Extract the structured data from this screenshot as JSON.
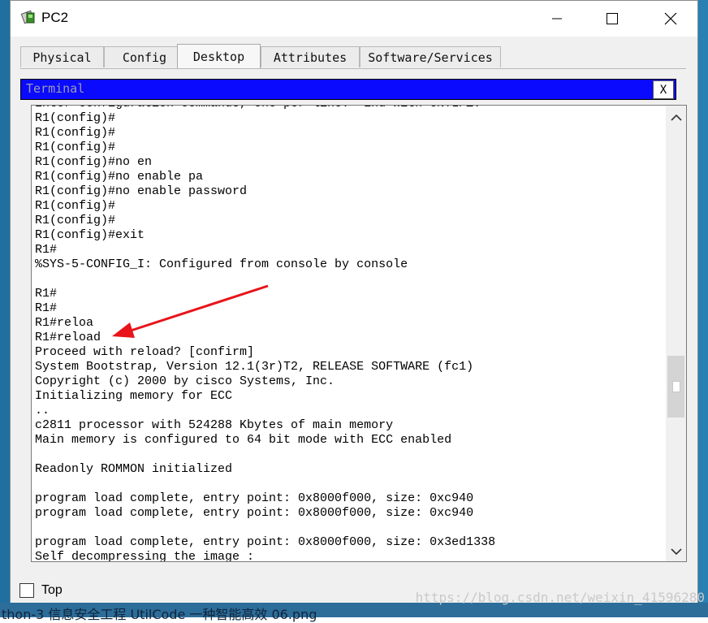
{
  "window": {
    "title": "PC2",
    "controls": {
      "minimize": "minimize-icon",
      "maximize": "maximize-icon",
      "close": "close-icon"
    }
  },
  "tabs": [
    {
      "label": "Physical",
      "active": false
    },
    {
      "label": "Config",
      "active": false
    },
    {
      "label": "Desktop",
      "active": true
    },
    {
      "label": "Attributes",
      "active": false
    },
    {
      "label": "Software/Services",
      "active": false
    }
  ],
  "terminal": {
    "title": "Terminal",
    "close_label": "X",
    "lines": [
      "Enter configuration commands, one per line.  End with CNTL/Z.",
      "R1(config)#",
      "R1(config)#",
      "R1(config)#",
      "R1(config)#no en",
      "R1(config)#no enable pa",
      "R1(config)#no enable password",
      "R1(config)#",
      "R1(config)#",
      "R1(config)#exit",
      "R1#",
      "%SYS-5-CONFIG_I: Configured from console by console",
      "",
      "R1#",
      "R1#",
      "R1#reloa",
      "R1#reload",
      "Proceed with reload? [confirm]",
      "System Bootstrap, Version 12.1(3r)T2, RELEASE SOFTWARE (fc1)",
      "Copyright (c) 2000 by cisco Systems, Inc.",
      "Initializing memory for ECC",
      "..",
      "c2811 processor with 524288 Kbytes of main memory",
      "Main memory is configured to 64 bit mode with ECC enabled",
      "",
      "Readonly ROMMON initialized",
      "",
      "program load complete, entry point: 0x8000f000, size: 0xc940",
      "program load complete, entry point: 0x8000f000, size: 0xc940",
      "",
      "program load complete, entry point: 0x8000f000, size: 0x3ed1338",
      "Self decompressing the image :"
    ]
  },
  "footer": {
    "top_label": "Top",
    "top_checked": false
  },
  "desktop": {
    "taskbar_text": "thon-3    信息安全工程 UtilCode    一种智能高效    06.png",
    "watermark": "https://blog.csdn.net/weixin_41596280"
  },
  "colors": {
    "terminal_titlebar": "#0a0aff",
    "annotation_arrow": "#e8141a"
  }
}
